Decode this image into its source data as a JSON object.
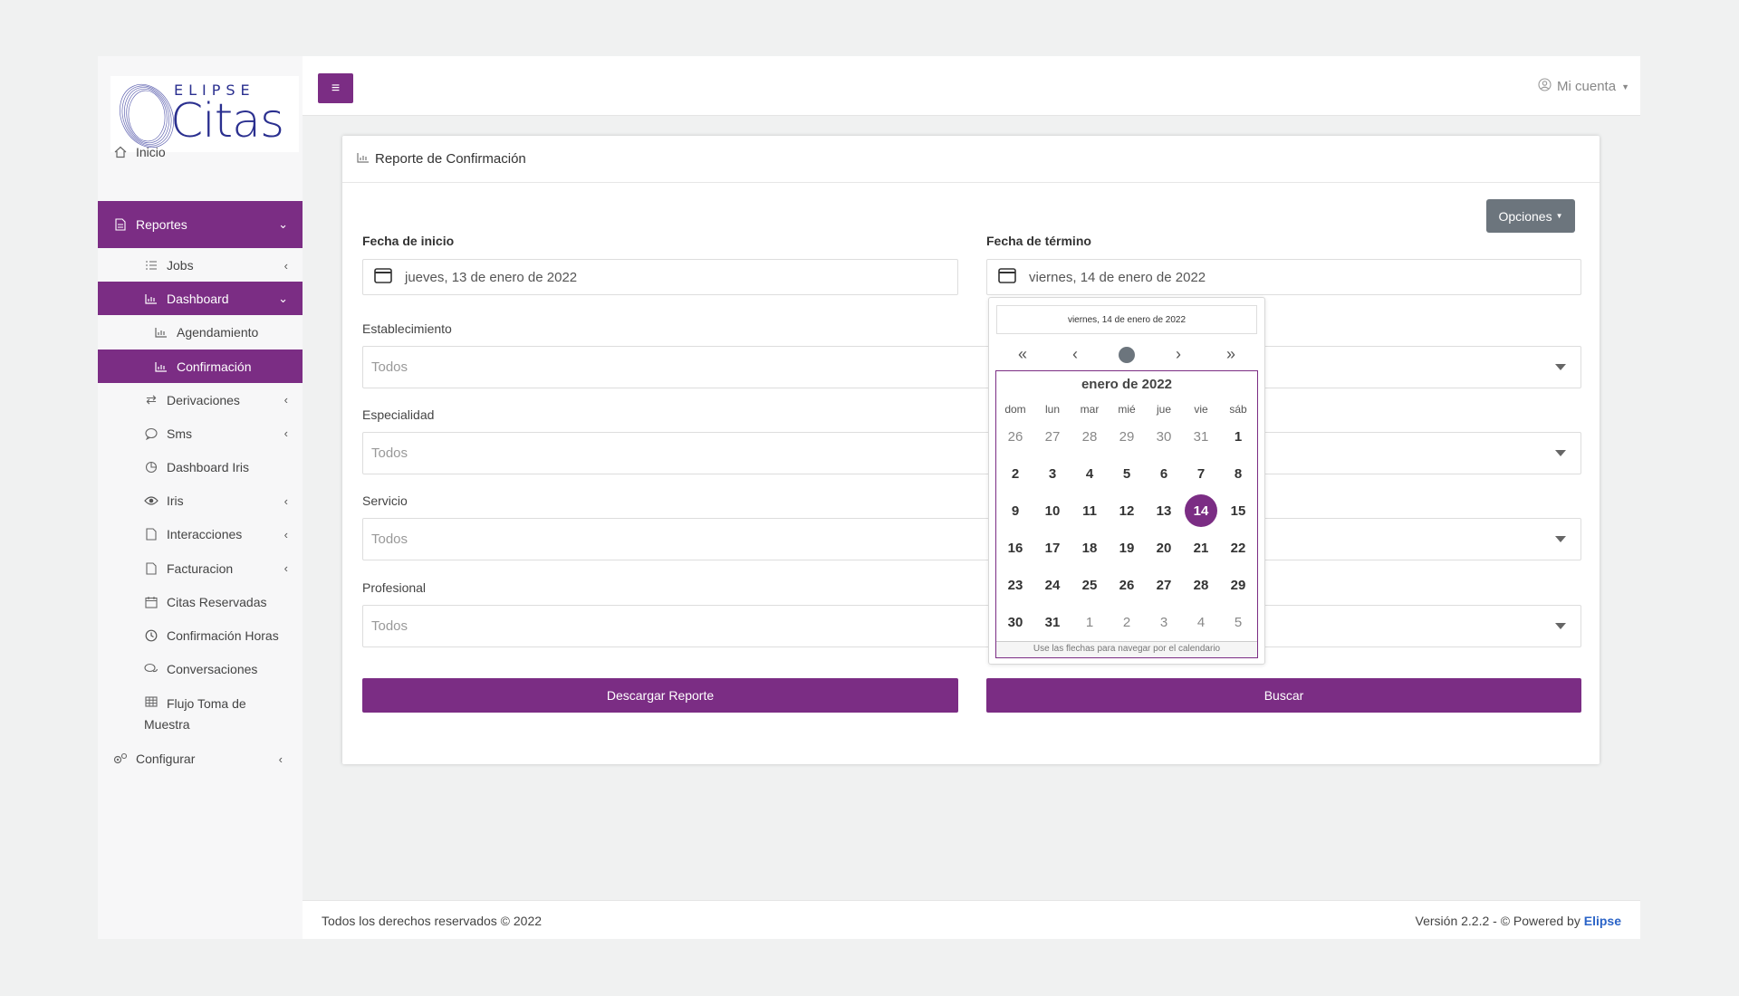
{
  "logo": {
    "line1": "ELIPSE",
    "line2": "Citas"
  },
  "sidebar": {
    "items": [
      {
        "label": "Inicio",
        "icon": "home-icon"
      },
      {
        "label": "Reportes",
        "icon": "report-icon"
      },
      {
        "label": "Jobs",
        "icon": "list-icon"
      },
      {
        "label": "Dashboard",
        "icon": "bar-chart-icon"
      },
      {
        "label": "Agendamiento",
        "icon": "bar-chart-icon"
      },
      {
        "label": "Confirmación",
        "icon": "bar-chart-icon"
      },
      {
        "label": "Derivaciones",
        "icon": "exchange-icon"
      },
      {
        "label": "Sms",
        "icon": "chat-icon"
      },
      {
        "label": "Dashboard Iris",
        "icon": "pie-chart-icon"
      },
      {
        "label": "Iris",
        "icon": "eye-icon"
      },
      {
        "label": "Interacciones",
        "icon": "document-icon"
      },
      {
        "label": "Facturacion",
        "icon": "document-icon"
      },
      {
        "label": "Citas Reservadas",
        "icon": "calendar-icon"
      },
      {
        "label": "Confirmación Horas",
        "icon": "clock-icon"
      },
      {
        "label": "Conversaciones",
        "icon": "comments-icon"
      },
      {
        "label": "Flujo Toma de",
        "label2": "Muestra",
        "icon": "table-icon"
      },
      {
        "label": "Configurar",
        "icon": "cogs-icon"
      }
    ]
  },
  "topbar": {
    "menu_icon": "hamburger-icon",
    "account": "Mi cuenta"
  },
  "card": {
    "title": "Reporte de Confirmación",
    "options_button": "Opciones",
    "start_label": "Fecha de inicio",
    "start_value": "jueves, 13 de enero de 2022",
    "end_label": "Fecha de término",
    "end_value": "viernes, 14 de enero de 2022",
    "establecimiento_label": "Establecimiento",
    "especialidad_label": "Especialidad",
    "servicio_label": "Servicio",
    "profesional_label": "Profesional",
    "select_placeholder": "Todos",
    "download_button": "Descargar Reporte",
    "search_button": "Buscar"
  },
  "calendar": {
    "selected_text": "viernes, 14 de enero de 2022",
    "month": "enero de 2022",
    "weekdays": [
      "dom",
      "lun",
      "mar",
      "mié",
      "jue",
      "vie",
      "sáb"
    ],
    "weeks": [
      [
        "26",
        "27",
        "28",
        "29",
        "30",
        "31",
        "1"
      ],
      [
        "2",
        "3",
        "4",
        "5",
        "6",
        "7",
        "8"
      ],
      [
        "9",
        "10",
        "11",
        "12",
        "13",
        "14",
        "15"
      ],
      [
        "16",
        "17",
        "18",
        "19",
        "20",
        "21",
        "22"
      ],
      [
        "23",
        "24",
        "25",
        "26",
        "27",
        "28",
        "29"
      ],
      [
        "30",
        "31",
        "1",
        "2",
        "3",
        "4",
        "5"
      ]
    ],
    "selected_day": "14",
    "hint": "Use las flechas para navegar por el calendario",
    "accent": "#7b2d84"
  },
  "footer": {
    "left": "Todos los derechos reservados © 2022",
    "right_prefix": "Versión 2.2.2 - © Powered by",
    "brand": "Elipse"
  }
}
